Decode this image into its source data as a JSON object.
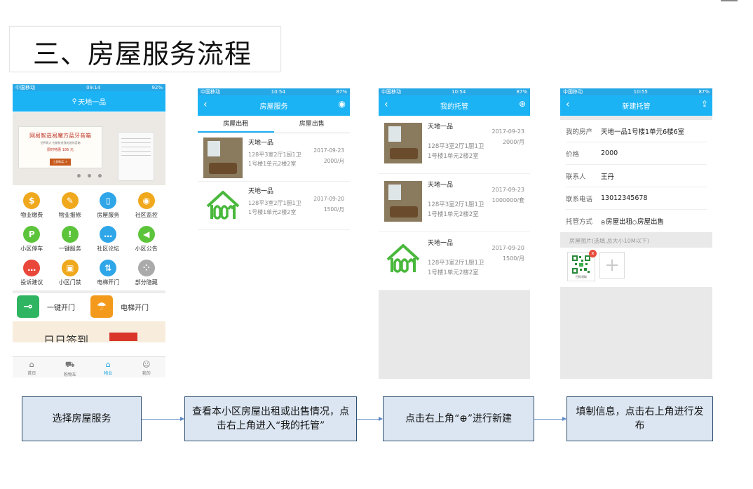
{
  "slide_title": "三、房屋服务流程",
  "phone1": {
    "status": {
      "left": "中国移动",
      "time": "09:14",
      "right": "92%"
    },
    "location": "天地一品",
    "banner": {
      "title": "网易智造易魔方蓝牙音箱",
      "subtitle": "世界再大 也能装进我的迷你音箱",
      "price": "限时特惠 186 元",
      "button": "立即购买 >"
    },
    "grid": [
      {
        "label": "物业缴费",
        "icon": "money-bag-icon",
        "color": "#f0a81c",
        "glyph": "$"
      },
      {
        "label": "物业报修",
        "icon": "wrench-icon",
        "color": "#f0a81c",
        "glyph": "✎"
      },
      {
        "label": "房屋服务",
        "icon": "door-icon",
        "color": "#2fa6e8",
        "glyph": "▯"
      },
      {
        "label": "社区监控",
        "icon": "camera-icon",
        "color": "#f0a81c",
        "glyph": "◉"
      },
      {
        "label": "小区停车",
        "icon": "parking-icon",
        "color": "#5cc43a",
        "glyph": "P"
      },
      {
        "label": "一键服务",
        "icon": "warning-icon",
        "color": "#5cc43a",
        "glyph": "!"
      },
      {
        "label": "社区论坛",
        "icon": "chat-icon",
        "color": "#2fa6e8",
        "glyph": "…"
      },
      {
        "label": "小区公告",
        "icon": "speaker-icon",
        "color": "#5cc43a",
        "glyph": "◀"
      },
      {
        "label": "投诉建议",
        "icon": "comment-icon",
        "color": "#e8473a",
        "glyph": "…"
      },
      {
        "label": "小区门禁",
        "icon": "gate-icon",
        "color": "#f0a81c",
        "glyph": "▣"
      },
      {
        "label": "电梯开门",
        "icon": "elevator-icon",
        "color": "#2fa6e8",
        "glyph": "⇅"
      },
      {
        "label": "部分隐藏",
        "icon": "more-icon",
        "color": "#aaaaaa",
        "glyph": "⁘"
      }
    ],
    "quick": [
      {
        "label": "一键开门",
        "icon": "key-icon",
        "color": "#2fb561",
        "glyph": "⊸"
      },
      {
        "label": "电梯开门",
        "icon": "umbrella-icon",
        "color": "#f39a1d",
        "glyph": "☂"
      }
    ],
    "promo": "日日签到",
    "tabbar": [
      {
        "label": "首页",
        "icon": "home-icon",
        "glyph": "⌂"
      },
      {
        "label": "购物车",
        "icon": "cart-icon",
        "glyph": "⛟"
      },
      {
        "label": "物业",
        "icon": "property-icon",
        "glyph": "⌂"
      },
      {
        "label": "我的",
        "icon": "user-icon",
        "glyph": "☺"
      }
    ]
  },
  "phone2": {
    "status": {
      "left": "中国移动",
      "time": "10:54",
      "right": "87%"
    },
    "title": "房屋服务",
    "tabs": [
      "房屋出租",
      "房屋出售"
    ],
    "items": [
      {
        "name": "天地一品",
        "desc": "128平3室2厅1厨1卫",
        "addr": "1号楼1单元2楼2室",
        "date": "2017-09-23",
        "price": "2000/月",
        "image": "photo"
      },
      {
        "name": "天地一品",
        "desc": "128平3室2厅1厨1卫",
        "addr": "1号楼1单元2楼2室",
        "date": "2017-09-20",
        "price": "1500/月",
        "image": "logo"
      }
    ]
  },
  "phone3": {
    "status": {
      "left": "中国移动",
      "time": "10:54",
      "right": "87%"
    },
    "title": "我的托管",
    "items": [
      {
        "name": "天地一品",
        "desc": "128平3室2厅1厨1卫",
        "addr": "1号楼1单元2楼2室",
        "date": "2017-09-23",
        "price": "2000/月",
        "image": "photo"
      },
      {
        "name": "天地一品",
        "desc": "128平3室2厅1厨1卫",
        "addr": "1号楼1单元2楼2室",
        "date": "2017-09-23",
        "price": "1000000/套",
        "image": "photo"
      },
      {
        "name": "天地一品",
        "desc": "128平3室2厅1厨1卫",
        "addr": "1号楼1单元2楼2室",
        "date": "2017-09-20",
        "price": "1500/月",
        "image": "logo"
      }
    ]
  },
  "phone4": {
    "status": {
      "left": "中国移动",
      "time": "10:55",
      "right": "87%"
    },
    "title": "新建托管",
    "fields": [
      {
        "label": "我的房产",
        "value": "天地一品1号楼1单元6楼6室"
      },
      {
        "label": "价格",
        "value": "2000"
      },
      {
        "label": "联系人",
        "value": "王丹"
      },
      {
        "label": "联系电话",
        "value": "13012345678"
      }
    ],
    "mode": {
      "label": "托管方式",
      "options": [
        "房屋出租",
        "房屋出售"
      ],
      "selected": "房屋出租"
    },
    "photo_hint": "房屋图片(选填,总大小10M以下)",
    "qr_label": "扫码领取",
    "delete": "x"
  },
  "flow": [
    "选择房屋服务",
    "查看本小区房屋出租或出售情况，点击右上角进入“我的托管”",
    "点击右上角“⊕”进行新建",
    "填制信息，点击右上角进行发布"
  ]
}
